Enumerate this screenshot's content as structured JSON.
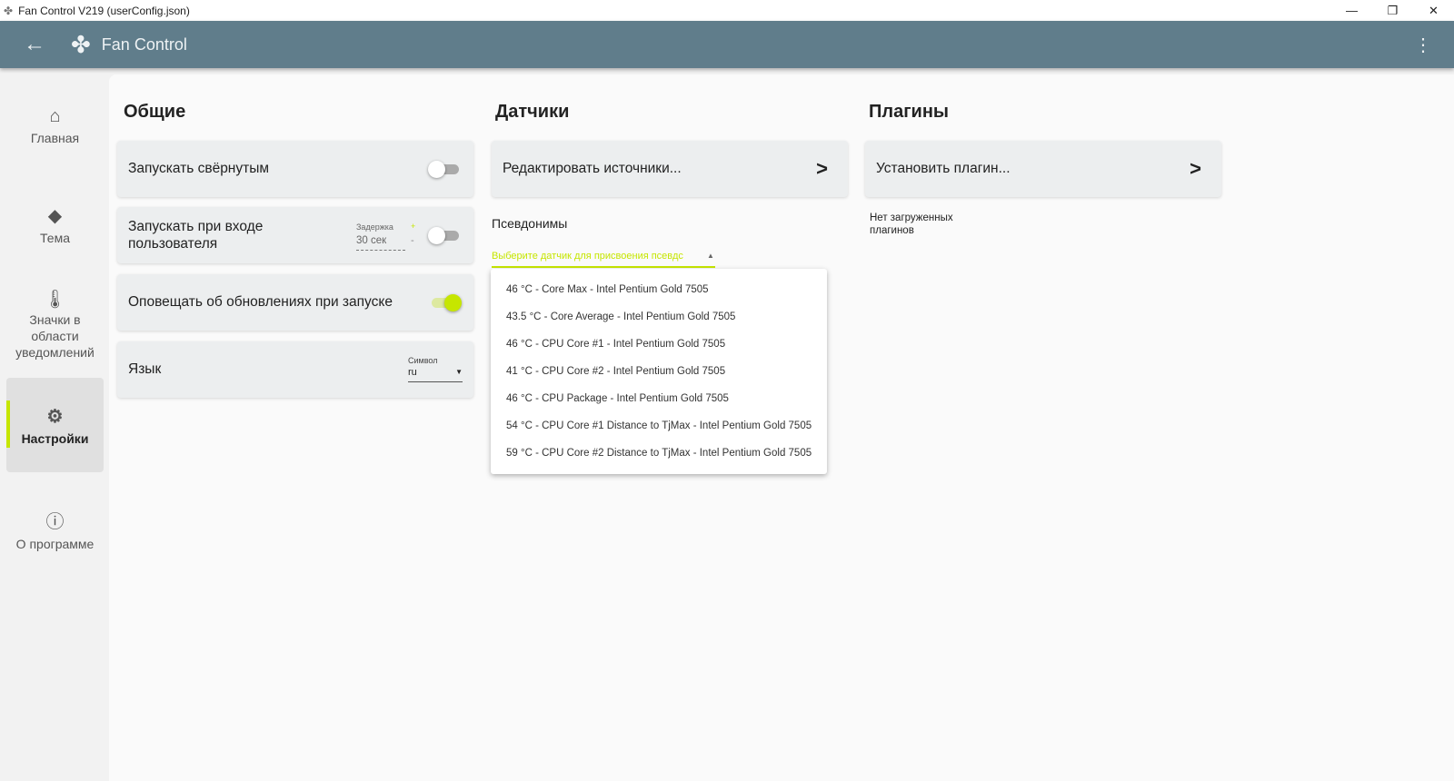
{
  "window": {
    "title": "Fan Control V219 (userConfig.json)",
    "min": "—",
    "max": "❐",
    "close": "✕"
  },
  "appbar": {
    "title": "Fan Control",
    "back": "←",
    "more": "⋮",
    "logo": "✤"
  },
  "sidebar": {
    "items": [
      {
        "label": "Главная",
        "icon": "⌂"
      },
      {
        "label": "Тема",
        "icon": "◆"
      },
      {
        "label": "Значки в области уведомлений",
        "icon": "🌡"
      },
      {
        "label": "Настройки",
        "icon": "⚙"
      },
      {
        "label": "О программе",
        "icon": "ⓘ"
      }
    ]
  },
  "general": {
    "heading": "Общие",
    "start_minimized": "Запускать свёрнутым",
    "start_on_login": "Запускать при входе пользователя",
    "delay_label": "Задержка",
    "delay_value": "30 сек",
    "delay_plus": "+",
    "delay_minus": "-",
    "notify_updates": "Оповещать об обновлениях при запуске",
    "language": "Язык",
    "lang_field_label": "Символ",
    "lang_value": "ru"
  },
  "sensors": {
    "heading": "Датчики",
    "edit_sources": "Редактировать источники...",
    "aliases": "Псевдонимы",
    "select_placeholder": "Выберите датчик для присвоения псевдс",
    "options": [
      "46 °C - Core Max - Intel Pentium Gold 7505",
      "43.5 °C - Core Average - Intel Pentium Gold 7505",
      "46 °C - CPU Core #1 - Intel Pentium Gold 7505",
      "41 °C - CPU Core #2 - Intel Pentium Gold 7505",
      "46 °C - CPU Package - Intel Pentium Gold 7505",
      "54 °C - CPU Core #1 Distance to TjMax - Intel Pentium Gold 7505",
      "59 °C - CPU Core #2 Distance to TjMax - Intel Pentium Gold 7505"
    ]
  },
  "plugins": {
    "heading": "Плагины",
    "install": "Установить плагин...",
    "none_loaded": "Нет загруженных плагинов"
  },
  "colors": {
    "header": "#607d8b",
    "accent": "#c6e600"
  }
}
